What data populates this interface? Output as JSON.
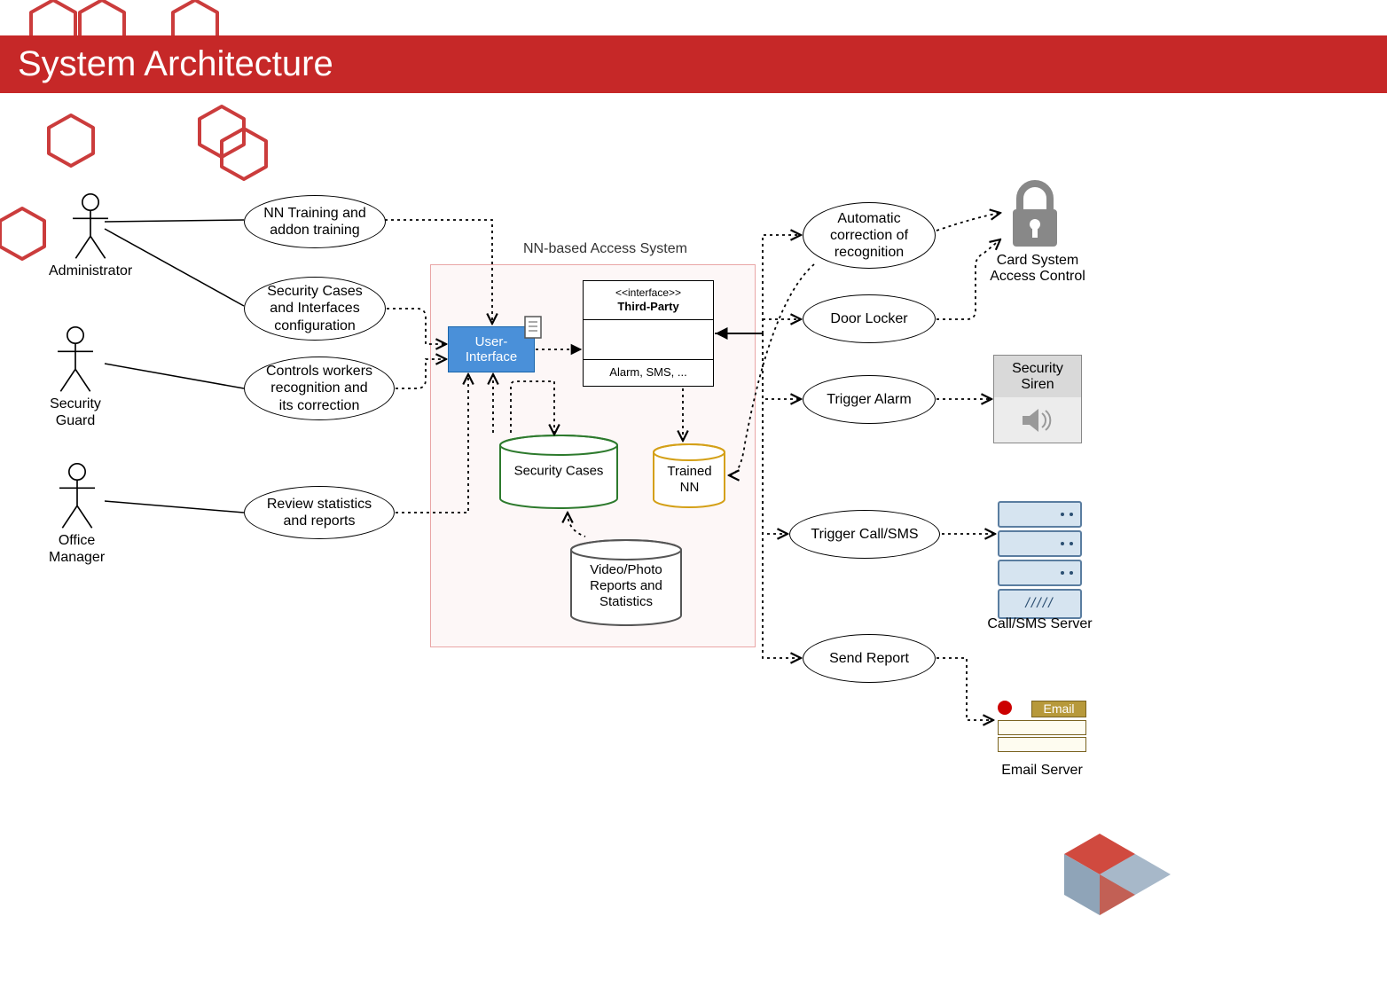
{
  "title": "System Architecture",
  "boundary_label": "NN-based Access System",
  "actors": {
    "admin": "Administrator",
    "guard": "Security\nGuard",
    "manager": "Office\nManager"
  },
  "usecases_left": {
    "nn_training": "NN Training and\naddon training",
    "sec_config": "Security Cases\nand Interfaces\nconfiguration",
    "controls": "Controls workers\nrecognition and\nits correction",
    "review": "Review statistics\nand reports"
  },
  "center": {
    "user_interface": "User-\nInterface",
    "third_party_stereo": "<<interface>>",
    "third_party_name": "Third-Party",
    "third_party_ops": "Alarm, SMS, ...",
    "cyl_cases": "Security Cases",
    "cyl_nn": "Trained\nNN",
    "cyl_reports": "Video/Photo\nReports and\nStatistics"
  },
  "usecases_right": {
    "auto_corr": "Automatic\ncorrection of\nrecognition",
    "door": "Door Locker",
    "alarm": "Trigger Alarm",
    "call": "Trigger Call/SMS",
    "report": "Send Report"
  },
  "devices": {
    "card": "Card System\nAccess Control",
    "siren": "Security\nSiren",
    "server": "Call/SMS Server",
    "email_badge": "Email",
    "email": "Email Server",
    "server_base": "/////"
  }
}
